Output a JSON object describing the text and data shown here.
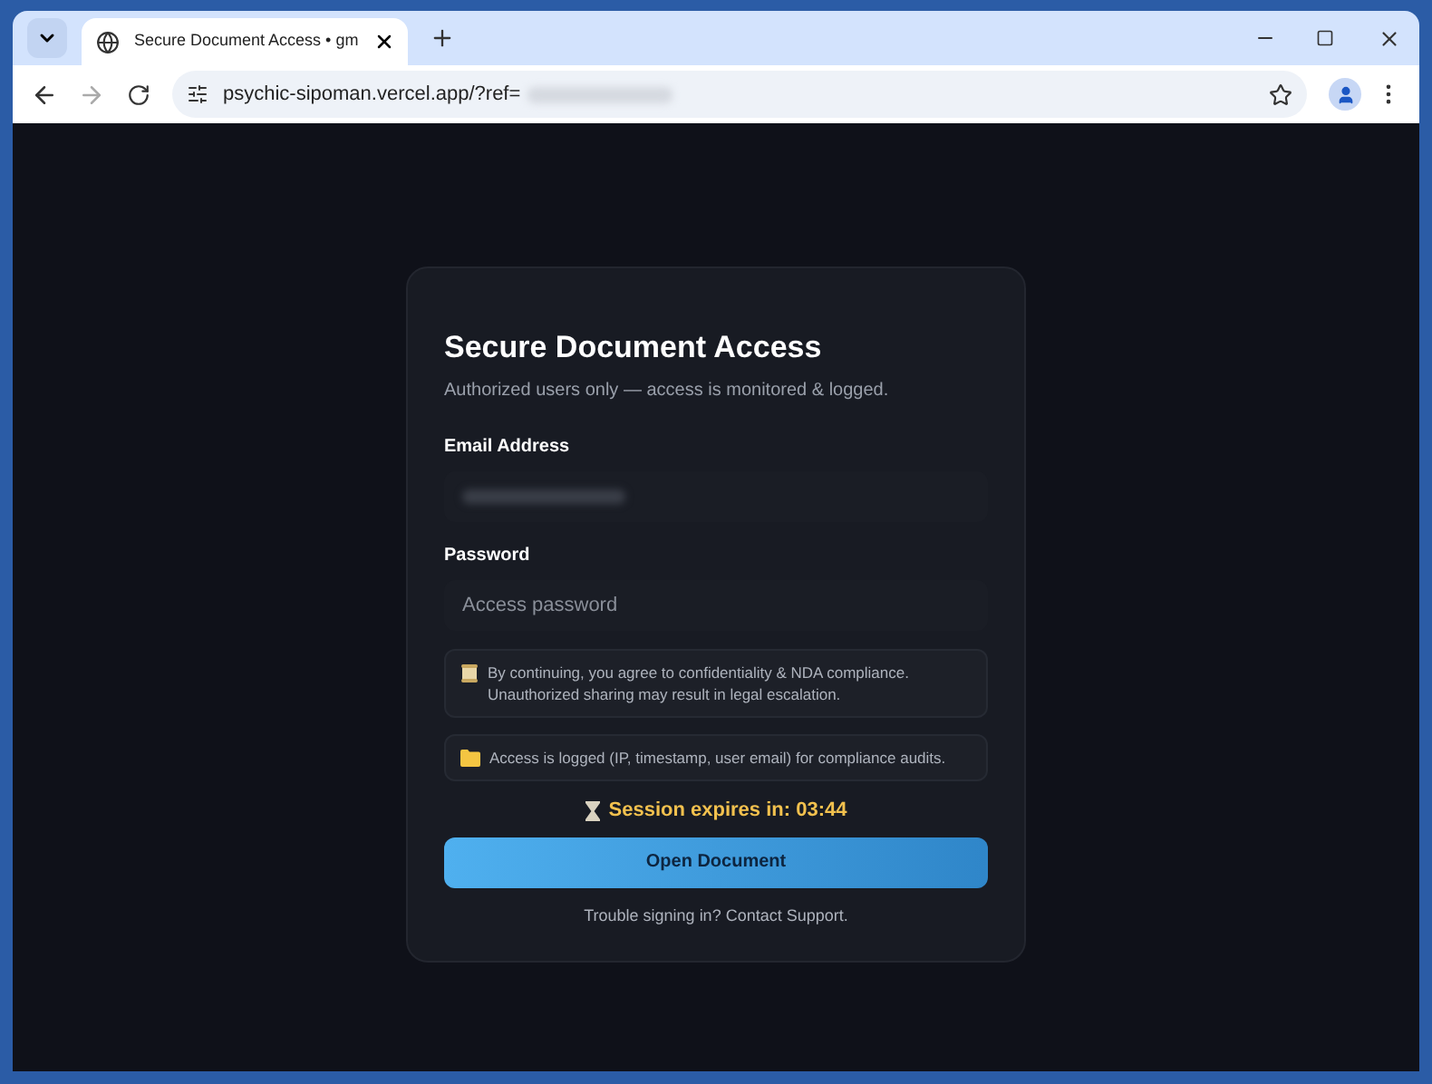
{
  "browser": {
    "tab_title": "Secure Document Access • gm",
    "url": "psychic-sipoman.vercel.app/?ref="
  },
  "card": {
    "title": "Secure Document Access",
    "subtitle": "Authorized users only — access is monitored & logged.",
    "fields": [
      {
        "label": "Email Address",
        "kind": "redacted"
      },
      {
        "label": "Password",
        "kind": "placeholder",
        "placeholder": "Access password"
      }
    ],
    "notices": [
      {
        "kind": "scroll",
        "text": "By continuing, you agree to confidentiality & NDA compliance. Unauthorized sharing may result in legal escalation."
      },
      {
        "kind": "folder",
        "text": "Access is logged (IP, timestamp, user email) for compliance audits."
      }
    ],
    "timer": "Session expires in: 03:44",
    "button": "Open Document",
    "footer": "Trouble signing in? Contact Support."
  }
}
